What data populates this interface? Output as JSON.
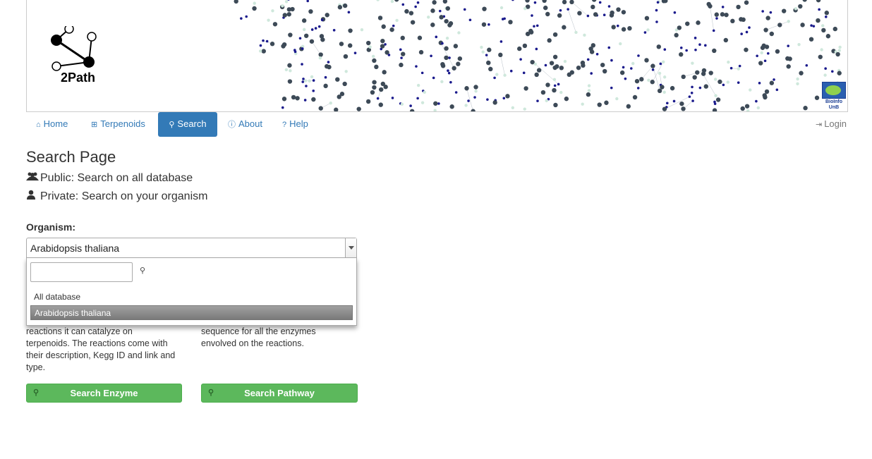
{
  "banner": {
    "logo_text": "2Path",
    "bioinfo_line1": "BioInfo",
    "bioinfo_line2": "UnB"
  },
  "nav": {
    "items": [
      {
        "label": "Home",
        "icon": "home-icon"
      },
      {
        "label": "Terpenoids",
        "icon": "sitemap-icon"
      },
      {
        "label": "Search",
        "icon": "search-icon",
        "active": true
      },
      {
        "label": "About",
        "icon": "info-icon"
      },
      {
        "label": "Help",
        "icon": "question-icon"
      }
    ],
    "login": "Login"
  },
  "page": {
    "title": "Search Page",
    "public_line": "Public: Search on all database",
    "private_line": "Private: Search on your organism",
    "organism_label": "Organism:"
  },
  "select": {
    "value": "Arabidopsis thaliana",
    "options": [
      "All database",
      "Arabidopsis thaliana"
    ]
  },
  "enzyme": {
    "desc_line1": "reactions it can catalyze on",
    "desc_line2": "terpenoids. The reactions come with",
    "desc_line3": "their description, Kegg ID and link and",
    "desc_line4": "type.",
    "button": "Search Enzyme"
  },
  "pathway": {
    "desc_line1": "sequence for all the enzymes",
    "desc_line2": "envolved on the reactions.",
    "button": "Search Pathway"
  },
  "colors": {
    "primary": "#337ab7",
    "success": "#5cb85c"
  }
}
